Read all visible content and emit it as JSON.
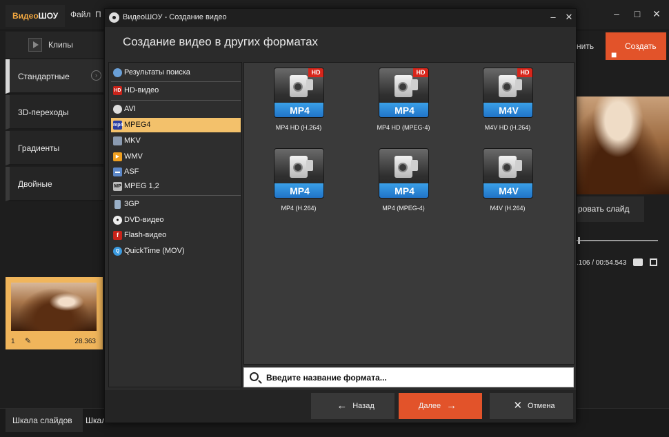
{
  "app": {
    "logo_part1": "Видео",
    "logo_part2": "ШОУ",
    "menu": [
      "Файл",
      "П"
    ],
    "clips_tab": "Клипы",
    "categories": [
      "Стандартные",
      "3D-переходы",
      "Градиенты",
      "Двойные"
    ],
    "create_button": "Создать",
    "save_partial": "нить",
    "slide_button": "ровать слайд",
    "time_label": ".106 / 00:54.543",
    "thumb": {
      "number": "1",
      "duration": "28.363"
    },
    "bottom_tabs": [
      "Шкала слайдов",
      "Шкал"
    ]
  },
  "dialog": {
    "title": "ВидеоШОУ - Создание видео",
    "header": "Создание видео в других форматах",
    "formats": [
      {
        "label": "Результаты поиска",
        "icon": "search-globe-icon"
      },
      {
        "label": "HD-видео",
        "icon": "hd-icon"
      },
      {
        "label": "AVI",
        "icon": "film-reel-icon"
      },
      {
        "label": "MPEG4",
        "icon": "mp4-icon"
      },
      {
        "label": "MKV",
        "icon": "mkv-icon"
      },
      {
        "label": "WMV",
        "icon": "wmv-icon"
      },
      {
        "label": "ASF",
        "icon": "asf-icon"
      },
      {
        "label": "MPEG 1,2",
        "icon": "mpeg-icon"
      },
      {
        "label": "3GP",
        "icon": "phone-icon"
      },
      {
        "label": "DVD-видео",
        "icon": "dvd-icon"
      },
      {
        "label": "Flash-видео",
        "icon": "flash-icon"
      },
      {
        "label": "QuickTime (MOV)",
        "icon": "quicktime-icon"
      }
    ],
    "selected_format": "MPEG4",
    "tiles": [
      {
        "band": "MP4",
        "hd": "HD",
        "caption": "MP4 HD (H.264)"
      },
      {
        "band": "MP4",
        "hd": "HD",
        "caption": "MP4 HD (MPEG-4)"
      },
      {
        "band": "M4V",
        "hd": "HD",
        "caption": "M4V HD (H.264)"
      },
      {
        "band": "MP4",
        "hd": "",
        "caption": "MP4 (H.264)"
      },
      {
        "band": "MP4",
        "hd": "",
        "caption": "MP4 (MPEG-4)"
      },
      {
        "band": "M4V",
        "hd": "",
        "caption": "M4V (H.264)"
      }
    ],
    "search_placeholder": "Введите название формата...",
    "buttons": {
      "back": "Назад",
      "next": "Далее",
      "cancel": "Отмена"
    },
    "colors": {
      "accent": "#e2532a",
      "selection": "#f3c16b",
      "format_band": "#2a86d8",
      "hd_badge": "#d8261b"
    }
  }
}
